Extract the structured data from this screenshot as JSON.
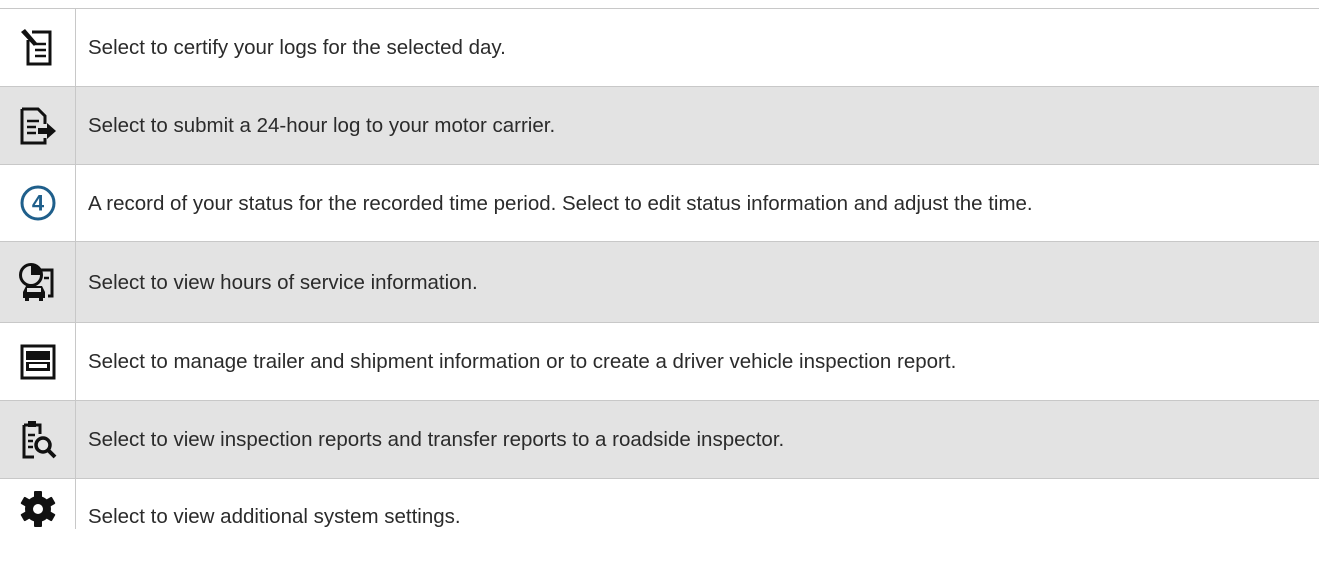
{
  "colors": {
    "icon": "#111111",
    "accent": "#1f5f8b",
    "shaded_row": "#e3e3e3",
    "rule": "#c8c8c8"
  },
  "rows": [
    {
      "icon": "certify-log-icon",
      "text": "Select to certify your logs for the selected day."
    },
    {
      "icon": "submit-log-icon",
      "text": "Select to submit a 24-hour log to your motor carrier."
    },
    {
      "icon": "circled-number-4-icon",
      "icon_label": "4",
      "text": "A record of your status for the recorded time period. Select to edit status information and adjust the time."
    },
    {
      "icon": "hours-of-service-icon",
      "text": "Select to view hours of service information."
    },
    {
      "icon": "truck-icon",
      "text": "Select to manage trailer and shipment information or to create a driver vehicle inspection report."
    },
    {
      "icon": "inspection-report-icon",
      "text": "Select to view inspection reports and transfer reports to a roadside inspector."
    },
    {
      "icon": "settings-gear-icon",
      "text": "Select to view additional system settings."
    }
  ]
}
